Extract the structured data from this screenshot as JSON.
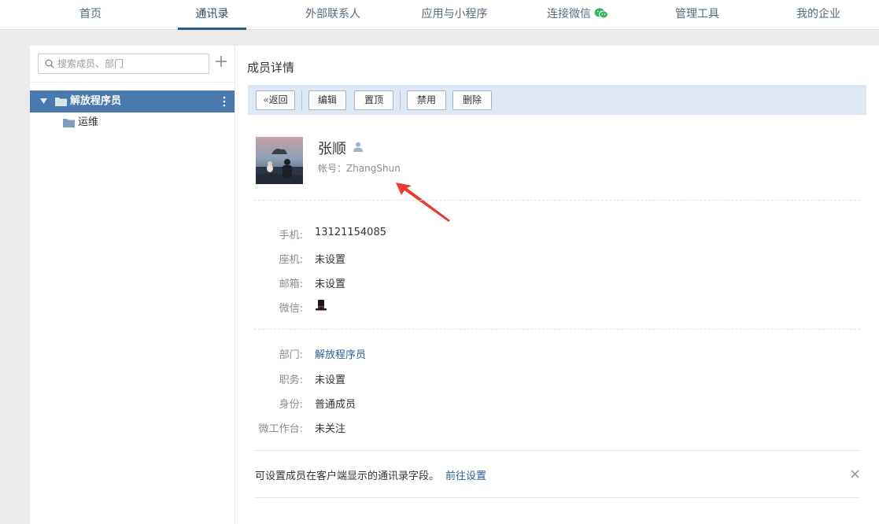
{
  "nav": {
    "items": [
      {
        "label": "首页"
      },
      {
        "label": "通讯录"
      },
      {
        "label": "外部联系人"
      },
      {
        "label": "应用与小程序"
      },
      {
        "label": "连接微信"
      },
      {
        "label": "管理工具"
      },
      {
        "label": "我的企业"
      }
    ],
    "active_index": 1,
    "wechat_icon_color": "#2fb65e"
  },
  "sidebar": {
    "search_placeholder": "搜索成员、部门",
    "tree": {
      "root_label": "解放程序员",
      "children": [
        {
          "label": "运维"
        }
      ]
    },
    "selected_color": "#4a79ad"
  },
  "main": {
    "title": "成员详情",
    "toolbar": {
      "back": "返回",
      "edit": "编辑",
      "pin": "置顶",
      "disable": "禁用",
      "delete": "删除"
    },
    "member": {
      "name": "张顺",
      "account": "帐号：ZhangShun"
    },
    "contact": {
      "mobile_label": "手机:",
      "mobile_value": "13121154085",
      "phone_label": "座机:",
      "phone_value": "未设置",
      "email_label": "邮箱:",
      "email_value": "未设置",
      "wechat_label": "微信:",
      "wechat_icon": "top-hat-icon"
    },
    "org": {
      "dept_label": "部门:",
      "dept_value": "解放程序员",
      "position_label": "职务:",
      "position_value": "未设置",
      "identity_label": "身份:",
      "identity_value": "普通成员",
      "workbench_label": "微工作台:",
      "workbench_value": "未关注"
    },
    "tip": {
      "text": "可设置成员在客户端显示的通讯录字段。",
      "link": "前往设置"
    },
    "link_color": "#2b5f96",
    "annotation_color": "#e83a2f"
  }
}
